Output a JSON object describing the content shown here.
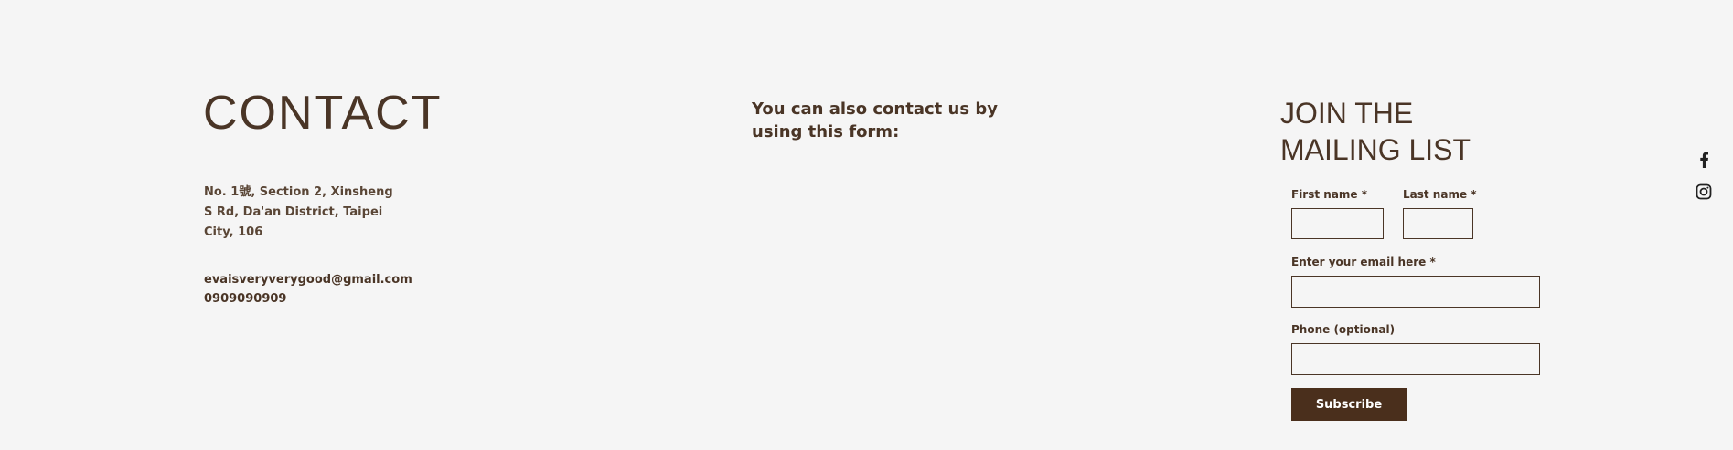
{
  "contact": {
    "title": "CONTACT",
    "address": "No. 1號, Section 2, Xinsheng S Rd, Da'an District, Taipei City, 106",
    "email": "evaisveryverygood@gmail.com",
    "phone": "0909090909"
  },
  "form_note": "You can also contact us by using this form:",
  "mailing": {
    "title": "JOIN THE MAILING LIST",
    "first_name_label": "First name *",
    "last_name_label": "Last name *",
    "email_label": "Enter your email here *",
    "phone_label": "Phone (optional)",
    "first_name_value": "",
    "last_name_value": "",
    "email_value": "",
    "phone_value": "",
    "subscribe_label": "Subscribe"
  },
  "social": {
    "icons": [
      "facebook-icon",
      "instagram-icon"
    ]
  },
  "colors": {
    "background": "#f5f5f5",
    "text": "#4a3526",
    "button": "#4a2f1c"
  }
}
